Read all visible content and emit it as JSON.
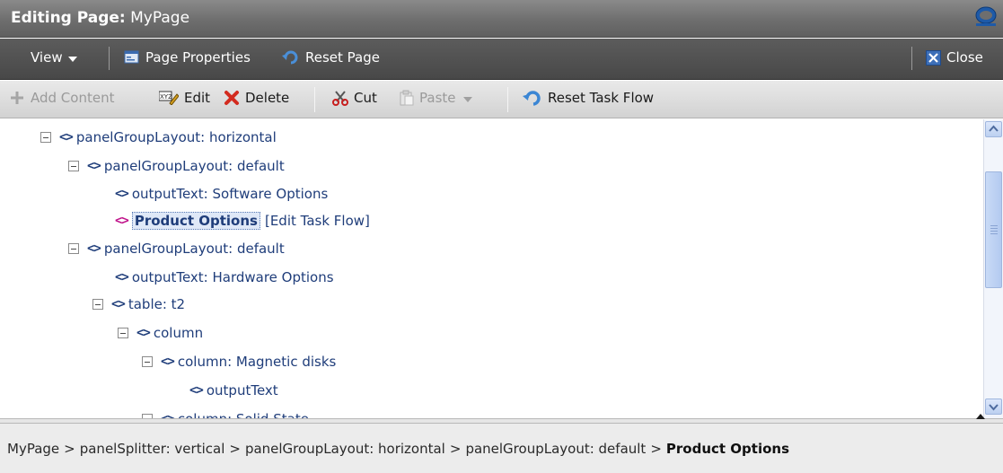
{
  "title": {
    "prefix": "Editing Page:",
    "page": "MyPage"
  },
  "menubar": {
    "view": "View",
    "page_properties": "Page Properties",
    "reset_page": "Reset Page",
    "close": "Close"
  },
  "toolbar": {
    "add_content": "Add Content",
    "edit": "Edit",
    "delete": "Delete",
    "cut": "Cut",
    "paste": "Paste",
    "reset_task_flow": "Reset Task Flow"
  },
  "tree": {
    "nodes": [
      {
        "label": "panelGroupLayout: horizontal",
        "depth": 0,
        "expandable": true
      },
      {
        "label": "panelGroupLayout: default",
        "depth": 1,
        "expandable": true
      },
      {
        "label": "outputText: Software Options",
        "depth": 2,
        "expandable": false
      },
      {
        "label": "Product Options",
        "depth": 2,
        "expandable": false,
        "selected": true,
        "extra": "[Edit Task Flow]"
      },
      {
        "label": "panelGroupLayout: default",
        "depth": 1,
        "expandable": true
      },
      {
        "label": "outputText: Hardware Options",
        "depth": 2,
        "expandable": false
      },
      {
        "label": "table: t2",
        "depth": 2,
        "expandable": true
      },
      {
        "label": "column",
        "depth": 3,
        "expandable": true
      },
      {
        "label": "column: Magnetic disks",
        "depth": 4,
        "expandable": true
      },
      {
        "label": "outputText",
        "depth": 5,
        "expandable": false
      },
      {
        "label": "column: Solid State",
        "depth": 4,
        "expandable": true
      }
    ]
  },
  "breadcrumb": {
    "items": [
      "MyPage",
      "panelSplitter: vertical",
      "panelGroupLayout: horizontal",
      "panelGroupLayout: default",
      "Product Options"
    ],
    "separator": ">"
  },
  "colors": {
    "title_bar": "#6e6e6e",
    "menu_bar": "#484848",
    "toolbar": "#d2d2d2",
    "tree_text": "#1f3d7a",
    "selected_tag": "#c0128a"
  },
  "icons": {
    "view": "caret-down-icon",
    "page_properties": "page-properties-icon",
    "reset_page": "undo-arrow-icon",
    "close": "close-x-icon",
    "add_content": "plus-icon",
    "edit": "edit-icon",
    "delete": "delete-x-icon",
    "cut": "scissors-icon",
    "paste": "clipboard-icon",
    "reset_task_flow": "undo-arrow-icon",
    "logo": "oracle-logo"
  }
}
